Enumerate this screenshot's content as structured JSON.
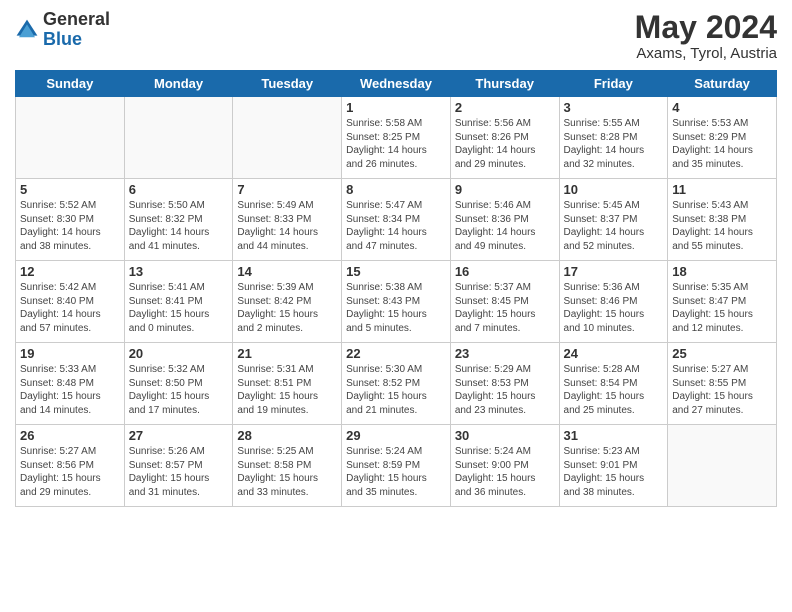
{
  "header": {
    "logo_general": "General",
    "logo_blue": "Blue",
    "month_year": "May 2024",
    "location": "Axams, Tyrol, Austria"
  },
  "days_of_week": [
    "Sunday",
    "Monday",
    "Tuesday",
    "Wednesday",
    "Thursday",
    "Friday",
    "Saturday"
  ],
  "weeks": [
    [
      {
        "day": "",
        "info": ""
      },
      {
        "day": "",
        "info": ""
      },
      {
        "day": "",
        "info": ""
      },
      {
        "day": "1",
        "info": "Sunrise: 5:58 AM\nSunset: 8:25 PM\nDaylight: 14 hours\nand 26 minutes."
      },
      {
        "day": "2",
        "info": "Sunrise: 5:56 AM\nSunset: 8:26 PM\nDaylight: 14 hours\nand 29 minutes."
      },
      {
        "day": "3",
        "info": "Sunrise: 5:55 AM\nSunset: 8:28 PM\nDaylight: 14 hours\nand 32 minutes."
      },
      {
        "day": "4",
        "info": "Sunrise: 5:53 AM\nSunset: 8:29 PM\nDaylight: 14 hours\nand 35 minutes."
      }
    ],
    [
      {
        "day": "5",
        "info": "Sunrise: 5:52 AM\nSunset: 8:30 PM\nDaylight: 14 hours\nand 38 minutes."
      },
      {
        "day": "6",
        "info": "Sunrise: 5:50 AM\nSunset: 8:32 PM\nDaylight: 14 hours\nand 41 minutes."
      },
      {
        "day": "7",
        "info": "Sunrise: 5:49 AM\nSunset: 8:33 PM\nDaylight: 14 hours\nand 44 minutes."
      },
      {
        "day": "8",
        "info": "Sunrise: 5:47 AM\nSunset: 8:34 PM\nDaylight: 14 hours\nand 47 minutes."
      },
      {
        "day": "9",
        "info": "Sunrise: 5:46 AM\nSunset: 8:36 PM\nDaylight: 14 hours\nand 49 minutes."
      },
      {
        "day": "10",
        "info": "Sunrise: 5:45 AM\nSunset: 8:37 PM\nDaylight: 14 hours\nand 52 minutes."
      },
      {
        "day": "11",
        "info": "Sunrise: 5:43 AM\nSunset: 8:38 PM\nDaylight: 14 hours\nand 55 minutes."
      }
    ],
    [
      {
        "day": "12",
        "info": "Sunrise: 5:42 AM\nSunset: 8:40 PM\nDaylight: 14 hours\nand 57 minutes."
      },
      {
        "day": "13",
        "info": "Sunrise: 5:41 AM\nSunset: 8:41 PM\nDaylight: 15 hours\nand 0 minutes."
      },
      {
        "day": "14",
        "info": "Sunrise: 5:39 AM\nSunset: 8:42 PM\nDaylight: 15 hours\nand 2 minutes."
      },
      {
        "day": "15",
        "info": "Sunrise: 5:38 AM\nSunset: 8:43 PM\nDaylight: 15 hours\nand 5 minutes."
      },
      {
        "day": "16",
        "info": "Sunrise: 5:37 AM\nSunset: 8:45 PM\nDaylight: 15 hours\nand 7 minutes."
      },
      {
        "day": "17",
        "info": "Sunrise: 5:36 AM\nSunset: 8:46 PM\nDaylight: 15 hours\nand 10 minutes."
      },
      {
        "day": "18",
        "info": "Sunrise: 5:35 AM\nSunset: 8:47 PM\nDaylight: 15 hours\nand 12 minutes."
      }
    ],
    [
      {
        "day": "19",
        "info": "Sunrise: 5:33 AM\nSunset: 8:48 PM\nDaylight: 15 hours\nand 14 minutes."
      },
      {
        "day": "20",
        "info": "Sunrise: 5:32 AM\nSunset: 8:50 PM\nDaylight: 15 hours\nand 17 minutes."
      },
      {
        "day": "21",
        "info": "Sunrise: 5:31 AM\nSunset: 8:51 PM\nDaylight: 15 hours\nand 19 minutes."
      },
      {
        "day": "22",
        "info": "Sunrise: 5:30 AM\nSunset: 8:52 PM\nDaylight: 15 hours\nand 21 minutes."
      },
      {
        "day": "23",
        "info": "Sunrise: 5:29 AM\nSunset: 8:53 PM\nDaylight: 15 hours\nand 23 minutes."
      },
      {
        "day": "24",
        "info": "Sunrise: 5:28 AM\nSunset: 8:54 PM\nDaylight: 15 hours\nand 25 minutes."
      },
      {
        "day": "25",
        "info": "Sunrise: 5:27 AM\nSunset: 8:55 PM\nDaylight: 15 hours\nand 27 minutes."
      }
    ],
    [
      {
        "day": "26",
        "info": "Sunrise: 5:27 AM\nSunset: 8:56 PM\nDaylight: 15 hours\nand 29 minutes."
      },
      {
        "day": "27",
        "info": "Sunrise: 5:26 AM\nSunset: 8:57 PM\nDaylight: 15 hours\nand 31 minutes."
      },
      {
        "day": "28",
        "info": "Sunrise: 5:25 AM\nSunset: 8:58 PM\nDaylight: 15 hours\nand 33 minutes."
      },
      {
        "day": "29",
        "info": "Sunrise: 5:24 AM\nSunset: 8:59 PM\nDaylight: 15 hours\nand 35 minutes."
      },
      {
        "day": "30",
        "info": "Sunrise: 5:24 AM\nSunset: 9:00 PM\nDaylight: 15 hours\nand 36 minutes."
      },
      {
        "day": "31",
        "info": "Sunrise: 5:23 AM\nSunset: 9:01 PM\nDaylight: 15 hours\nand 38 minutes."
      },
      {
        "day": "",
        "info": ""
      }
    ]
  ]
}
